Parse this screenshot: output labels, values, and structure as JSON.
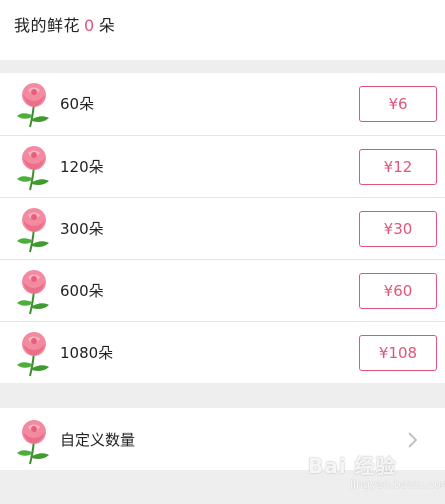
{
  "header": {
    "prefix": "我的鲜花",
    "count": "0",
    "suffix": "朵"
  },
  "options": [
    {
      "label": "60朵",
      "price": "¥6"
    },
    {
      "label": "120朵",
      "price": "¥12"
    },
    {
      "label": "300朵",
      "price": "¥30"
    },
    {
      "label": "600朵",
      "price": "¥60"
    },
    {
      "label": "1080朵",
      "price": "¥108"
    }
  ],
  "custom": {
    "label": "自定义数量"
  },
  "watermark": {
    "brand": "Bai 经验",
    "sub": "jingyan.baidu.com"
  },
  "colors": {
    "accent": "#e2547a",
    "background": "#eeeeee"
  },
  "icons": {
    "rose": "rose-icon",
    "chevron": "chevron-right-icon"
  }
}
